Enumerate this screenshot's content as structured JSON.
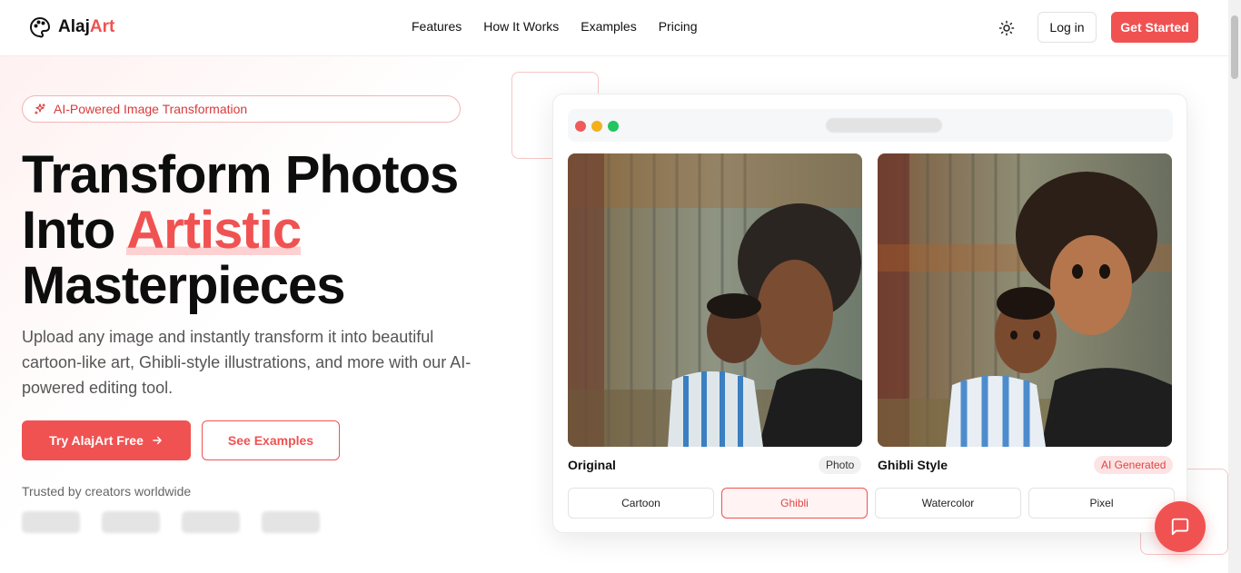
{
  "brand": {
    "name_part1": "Alaj",
    "name_part2": "Art",
    "accent_color": "#f05252"
  },
  "nav": {
    "links": [
      "Features",
      "How It Works",
      "Examples",
      "Pricing"
    ],
    "login_label": "Log in",
    "cta_label": "Get Started",
    "theme_icon": "sun-icon"
  },
  "hero": {
    "badge": "AI-Powered Image Transformation",
    "headline_line1": "Transform Photos",
    "headline_line2_prefix": "Into ",
    "headline_highlight": "Artistic",
    "headline_line3": "Masterpieces",
    "subtext": "Upload any image and instantly transform it into beautiful cartoon-like art, Ghibli-style illustrations, and more with our AI-powered editing tool.",
    "primary_cta": "Try AlajArt Free",
    "secondary_cta": "See Examples",
    "trusted_text": "Trusted by creators worldwide"
  },
  "preview": {
    "original_label": "Original",
    "original_tag": "Photo",
    "styled_label": "Ghibli Style",
    "styled_tag": "AI Generated",
    "style_options": [
      "Cartoon",
      "Ghibli",
      "Watercolor",
      "Pixel"
    ],
    "selected_style": "Ghibli"
  },
  "chat": {
    "icon": "chat-bubble-icon"
  }
}
